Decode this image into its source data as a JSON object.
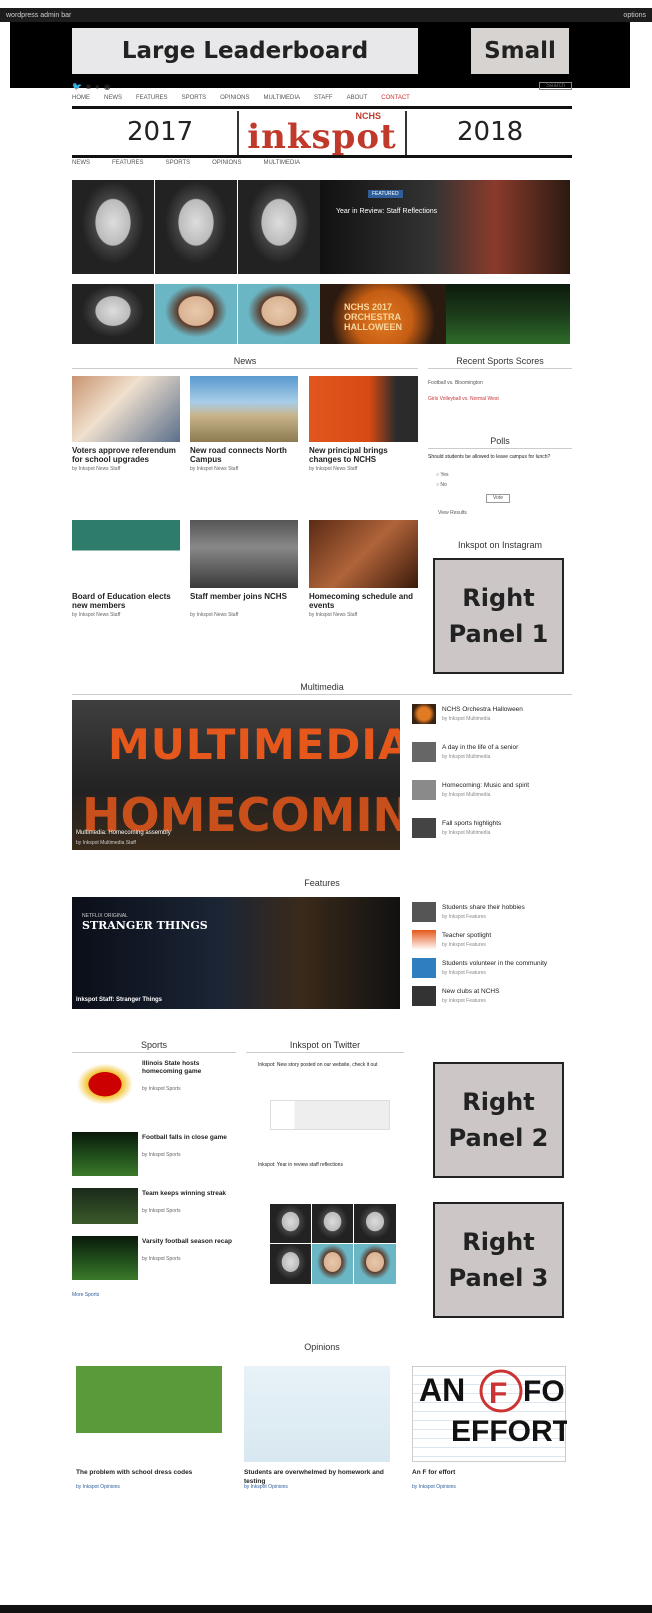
{
  "admin_bar": {
    "left": "wordpress admin bar",
    "right": "options"
  },
  "ads": {
    "large": "Large Leaderboard",
    "small": "Small",
    "right1": "Right Panel 1",
    "right2": "Right Panel 2",
    "right3": "Right Panel 3"
  },
  "social": {
    "search_label": "Search"
  },
  "top_nav": [
    "HOME",
    "NEWS",
    "FEATURES",
    "SPORTS",
    "OPINIONS",
    "MULTIMEDIA",
    "STAFF",
    "ABOUT",
    "CONTACT"
  ],
  "masthead": {
    "year_left": "2017",
    "year_right": "2018",
    "nchs": "NCHS",
    "name": "inkspot"
  },
  "section_nav": [
    "NEWS",
    "FEATURES",
    "SPORTS",
    "OPINIONS",
    "MULTIMEDIA"
  ],
  "hero": {
    "slide_label": "FEATURED",
    "slide_caption": "Year in Review: Staff Reflections",
    "pumpkin_text": "NCHS 2017 ORCHESTRA HALLOWEEN"
  },
  "sections": {
    "news": "News",
    "scores": "Recent Sports Scores",
    "polls": "Polls",
    "instagram": "Inkspot on Instagram",
    "multimedia": "Multimedia",
    "features": "Features",
    "sports": "Sports",
    "tweets": "Inkspot on Twitter",
    "opinions": "Opinions"
  },
  "news_articles": [
    {
      "title": "Voters approve referendum for school upgrades",
      "meta": "by Inkspot News Staff"
    },
    {
      "title": "New road connects North Campus",
      "meta": "by Inkspot News Staff"
    },
    {
      "title": "New principal brings changes to NCHS",
      "meta": "by Inkspot News Staff"
    },
    {
      "title": "Board of Education elects new members",
      "meta": "by Inkspot News Staff"
    },
    {
      "title": "Staff member joins NCHS",
      "meta": "by Inkspot News Staff"
    },
    {
      "title": "Homecoming schedule and events",
      "meta": "by Inkspot News Staff"
    }
  ],
  "scores": {
    "line1": "Football vs. Bloomington",
    "line2": "Girls Volleyball vs. Normal West"
  },
  "poll": {
    "question": "Should students be allowed to leave campus for lunch?",
    "opt1": "Yes",
    "opt2": "No",
    "vote": "Vote",
    "results": "View Results"
  },
  "multimedia": {
    "hero_title1": "MULTIMEDIA:",
    "hero_title2": "HOMECOMING",
    "hero_caption": "Multimedia: Homecoming assembly",
    "hero_meta": "by Inkspot Multimedia Staff",
    "items": [
      {
        "title": "NCHS Orchestra Halloween",
        "meta": "by Inkspot Multimedia"
      },
      {
        "title": "A day in the life of a senior",
        "meta": "by Inkspot Multimedia"
      },
      {
        "title": "Homecoming: Music and spirit",
        "meta": "by Inkspot Multimedia"
      },
      {
        "title": "Fall sports highlights",
        "meta": "by Inkspot Multimedia"
      }
    ]
  },
  "features": {
    "hero_kicker": "NETFLIX ORIGINAL",
    "hero_title": "STRANGER THINGS",
    "hero_caption": "Inkspot Staff: Stranger Things",
    "items": [
      {
        "title": "Students share their hobbies",
        "meta": "by Inkspot Features"
      },
      {
        "title": "Teacher spotlight",
        "meta": "by Inkspot Features"
      },
      {
        "title": "Students volunteer in the community",
        "meta": "by Inkspot Features"
      },
      {
        "title": "New clubs at NCHS",
        "meta": "by Inkspot Features"
      }
    ]
  },
  "sports": {
    "items": [
      {
        "title": "Illinois State hosts homecoming game",
        "meta": "by Inkspot Sports"
      },
      {
        "title": "Football falls in close game",
        "meta": "by Inkspot Sports"
      },
      {
        "title": "Team keeps winning streak",
        "meta": "by Inkspot Sports"
      },
      {
        "title": "Varsity football season recap",
        "meta": "by Inkspot Sports"
      }
    ],
    "more": "More Sports"
  },
  "tweets": {
    "t1": "Inkspot: New story posted on our website, check it out",
    "t2": "Inkspot: Year in review staff reflections"
  },
  "opinions": [
    {
      "title": "The problem with school dress codes",
      "meta": "by Inkspot Opinions"
    },
    {
      "title": "Students are overwhelmed by homework and testing",
      "meta": "by Inkspot Opinions"
    },
    {
      "title": "An F for effort",
      "meta": "by Inkspot Opinions"
    }
  ]
}
